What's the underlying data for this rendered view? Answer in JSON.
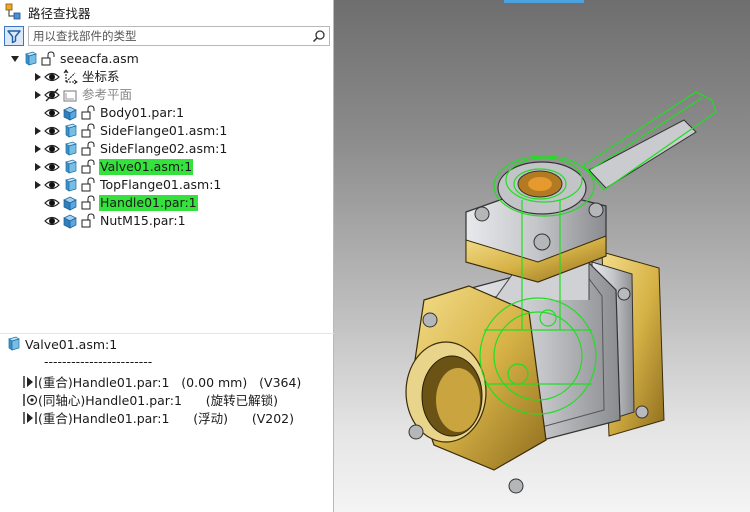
{
  "panel": {
    "title": "路径查找器",
    "search_placeholder": "用以查找部件的类型"
  },
  "tree": [
    {
      "label": "seeacfa.asm",
      "icon": "assembly-icon",
      "expander": "expanded",
      "eye": false,
      "level": 0,
      "style": "normal"
    },
    {
      "label": "坐标系",
      "icon": "coordinate-system-icon",
      "expander": "collapsed",
      "eye": "visible",
      "level": 1,
      "style": "normal"
    },
    {
      "label": "参考平面",
      "icon": "reference-plane-icon",
      "expander": "collapsed",
      "eye": "hidden",
      "level": 1,
      "style": "gray"
    },
    {
      "label": "Body01.par:1",
      "icon": "part-icon",
      "expander": "none",
      "eye": "visible",
      "level": 1,
      "style": "normal"
    },
    {
      "label": "SideFlange01.asm:1",
      "icon": "assembly-icon",
      "expander": "collapsed",
      "eye": "visible",
      "level": 1,
      "style": "normal"
    },
    {
      "label": "SideFlange02.asm:1",
      "icon": "assembly-icon",
      "expander": "collapsed",
      "eye": "visible",
      "level": 1,
      "style": "normal"
    },
    {
      "label": "Valve01.asm:1",
      "icon": "assembly-icon",
      "expander": "collapsed",
      "eye": "visible",
      "level": 1,
      "style": "highlight"
    },
    {
      "label": "TopFlange01.asm:1",
      "icon": "assembly-icon",
      "expander": "collapsed",
      "eye": "visible",
      "level": 1,
      "style": "normal"
    },
    {
      "label": "Handle01.par:1",
      "icon": "part-icon",
      "expander": "none",
      "eye": "visible",
      "level": 1,
      "style": "highlight"
    },
    {
      "label": "NutM15.par:1",
      "icon": "part-icon",
      "expander": "none",
      "eye": "visible",
      "level": 1,
      "style": "normal"
    }
  ],
  "relations": {
    "header": "Valve01.asm:1",
    "separator": "------------------------",
    "items": [
      {
        "icon": "mate-relation-icon",
        "text": "(重合)Handle01.par:1   (0.00 mm)   (V364)"
      },
      {
        "icon": "axial-align-icon",
        "text": "(同轴心)Handle01.par:1      (旋转已解锁)"
      },
      {
        "icon": "mate-relation-icon",
        "text": "(重合)Handle01.par:1      (浮动)      (V202)"
      }
    ]
  },
  "colors": {
    "highlight": "#35e13c",
    "wireframe": "#22dd22",
    "brass": "#d7b347",
    "steel": "#c6c8cc"
  }
}
